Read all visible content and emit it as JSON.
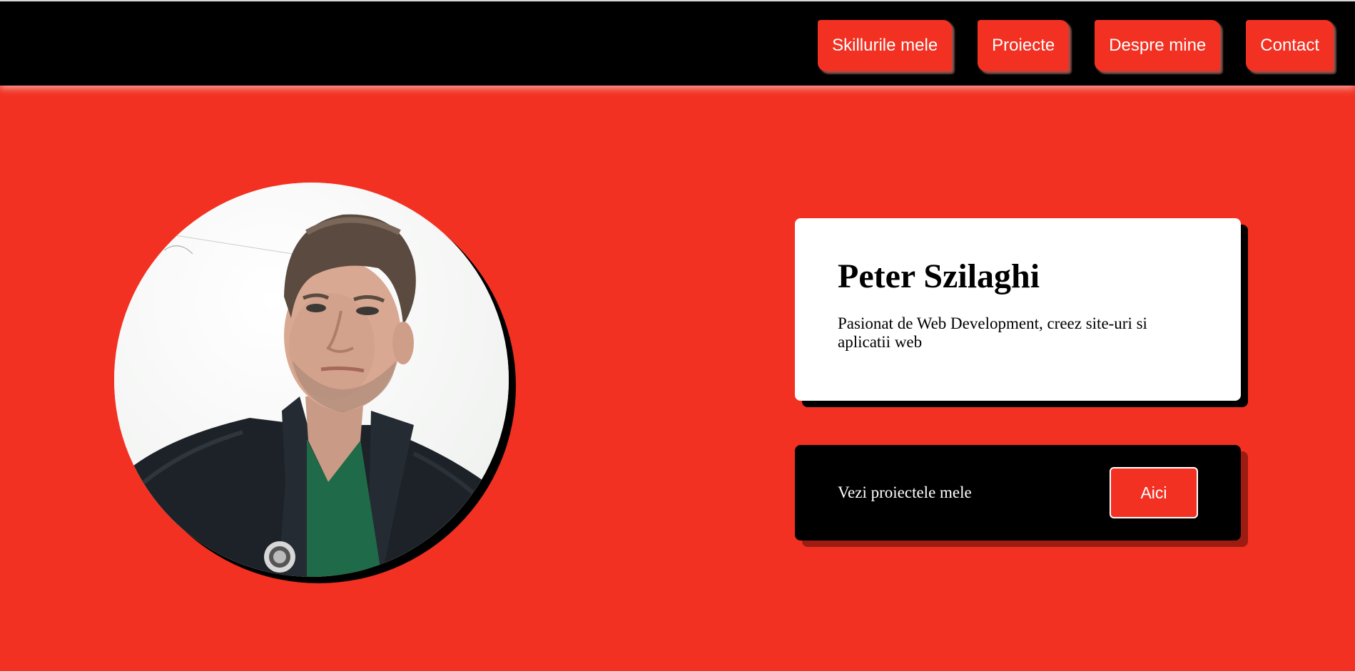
{
  "nav": {
    "items": [
      {
        "label": "Skillurile mele"
      },
      {
        "label": "Proiecte"
      },
      {
        "label": "Despre mine"
      },
      {
        "label": "Contact"
      }
    ]
  },
  "hero": {
    "photo_alt": "Profile photo",
    "name": "Peter Szilaghi",
    "tagline": "Pasionat de Web Development, creez site-uri si aplicatii web"
  },
  "cta": {
    "text": "Vezi proiectele mele",
    "button_label": "Aici"
  },
  "colors": {
    "accent": "#f23122",
    "dark": "#000000",
    "light": "#ffffff"
  }
}
